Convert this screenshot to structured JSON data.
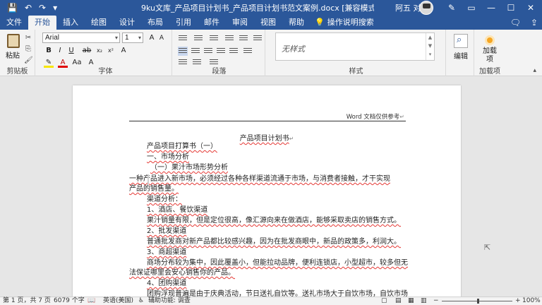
{
  "titlebar": {
    "doc_title": "9ku文库_产品项目计划书_产品项目计划书范文案例.docx [兼容模式] - Word",
    "user_name": "阿五 对"
  },
  "tabs": [
    "文件",
    "开始",
    "插入",
    "绘图",
    "设计",
    "布局",
    "引用",
    "邮件",
    "审阅",
    "视图",
    "帮助"
  ],
  "active_tab": "开始",
  "tell_me": "操作说明搜索",
  "ribbon": {
    "clipboard": {
      "paste": "粘贴",
      "label": "剪贴板"
    },
    "font": {
      "name": "Arial",
      "size": "1",
      "label": "字体"
    },
    "paragraph": {
      "label": "段落"
    },
    "styles": {
      "current": "无样式",
      "label": "样式"
    },
    "editing": {
      "button": "编辑"
    },
    "addins": {
      "button": "加载项",
      "label": "加载项"
    }
  },
  "document": {
    "header": "Word 文档仅供参考",
    "title": "产品项目计划书",
    "lines": [
      "产品项目打算书（一）",
      "一、市场分析",
      "（一）果汁市场形势分析",
      "一种产品进入新市场，必须经过各种各样渠道流通于市场，与消费者接触，才干实现",
      "产品的销售量。",
      "渠道分析：",
      "1、酒店、餐饮渠道",
      "果汁销量有限，但是定位很高，像汇源向来在做酒店，能够采取卖店的销售方式。",
      "2、批发渠道",
      "普通批发商对新产品都比较感兴趣，因为在批发商眼中，新品的政策多，利润大。",
      "3、商超渠道",
      "商场分布较为集中，因此覆盖小，但能拉动品牌，便利连锁店，小型超市，较多但无",
      "法保证哪里会安心销售你的产品。",
      "4、团购渠道",
      "团购浮现普遍是由于庆典活动，节日送礼自饮等。送礼市场大于自饮市场，自饮市场"
    ]
  },
  "statusbar": {
    "page": "第 1 页，共 7 页",
    "words": "6079 个字",
    "lang": "英语(美国)",
    "accessibility": "辅助功能: 调查",
    "zoom": "100%"
  }
}
